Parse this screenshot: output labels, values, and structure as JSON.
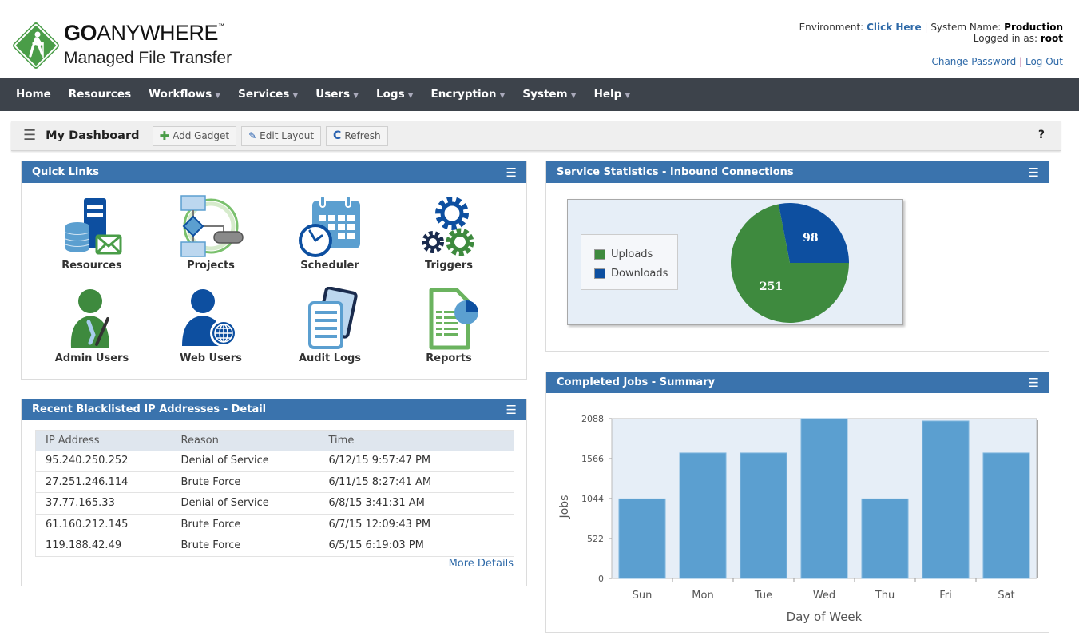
{
  "header": {
    "logo_bold": "GO",
    "logo_light": "ANYWHERE",
    "logo_tm": "™",
    "logo_subtitle": "Managed File Transfer",
    "environment_label": "Environment:",
    "environment_link": "Click Here",
    "separator": "|",
    "system_name_label": "System Name:",
    "system_name": "Production",
    "logged_in_label": "Logged in as:",
    "logged_in_user": "root",
    "change_password": "Change Password",
    "log_out": "Log Out"
  },
  "nav": {
    "items": [
      {
        "label": "Home",
        "dropdown": false
      },
      {
        "label": "Resources",
        "dropdown": false
      },
      {
        "label": "Workflows",
        "dropdown": true
      },
      {
        "label": "Services",
        "dropdown": true
      },
      {
        "label": "Users",
        "dropdown": true
      },
      {
        "label": "Logs",
        "dropdown": true
      },
      {
        "label": "Encryption",
        "dropdown": true
      },
      {
        "label": "System",
        "dropdown": true
      },
      {
        "label": "Help",
        "dropdown": true
      }
    ],
    "caret": "▼"
  },
  "toolbar": {
    "menu_icon": "☰",
    "title": "My Dashboard",
    "add_gadget": "Add Gadget",
    "edit_layout": "Edit Layout",
    "refresh": "Refresh",
    "help": "?"
  },
  "quick_links": {
    "title": "Quick Links",
    "menu_icon": "☰",
    "items": [
      {
        "label": "Resources",
        "icon": "resources-icon"
      },
      {
        "label": "Projects",
        "icon": "projects-icon"
      },
      {
        "label": "Scheduler",
        "icon": "scheduler-icon"
      },
      {
        "label": "Triggers",
        "icon": "triggers-icon"
      },
      {
        "label": "Admin Users",
        "icon": "admin-users-icon"
      },
      {
        "label": "Web Users",
        "icon": "web-users-icon"
      },
      {
        "label": "Audit Logs",
        "icon": "audit-logs-icon"
      },
      {
        "label": "Reports",
        "icon": "reports-icon"
      }
    ]
  },
  "blacklist": {
    "title": "Recent Blacklisted IP Addresses - Detail",
    "menu_icon": "☰",
    "columns": [
      "IP Address",
      "Reason",
      "Time"
    ],
    "rows": [
      [
        "95.240.250.252",
        "Denial of Service",
        "6/12/15 9:57:47 PM"
      ],
      [
        "27.251.246.114",
        "Brute Force",
        "6/11/15 8:27:41 AM"
      ],
      [
        "37.77.165.33",
        "Denial of Service",
        "6/8/15 3:41:31 AM"
      ],
      [
        "61.160.212.145",
        "Brute Force",
        "6/7/15 12:09:43 PM"
      ],
      [
        "119.188.42.49",
        "Brute Force",
        "6/5/15 6:19:03 PM"
      ]
    ],
    "more_details": "More Details"
  },
  "colors": {
    "nav_bg": "#3d434b",
    "panel_header": "#3a73ad",
    "uploads": "#3e8a3e",
    "downloads": "#0d4fa0",
    "bar": "#5b9fd0",
    "plot_bg": "#e6eef7",
    "link": "#2f6aa8"
  },
  "chart_data": [
    {
      "type": "pie",
      "title": "Service Statistics - Inbound Connections",
      "menu_icon": "☰",
      "categories": [
        "Uploads",
        "Downloads"
      ],
      "values": [
        251,
        98
      ],
      "colors": [
        "#3e8a3e",
        "#0d4fa0"
      ],
      "legend": "left"
    },
    {
      "type": "bar",
      "title": "Completed Jobs - Summary",
      "menu_icon": "☰",
      "categories": [
        "Sun",
        "Mon",
        "Tue",
        "Wed",
        "Thu",
        "Fri",
        "Sat"
      ],
      "values": [
        1040,
        1640,
        1640,
        2088,
        1040,
        2057,
        1640
      ],
      "xlabel": "Day of Week",
      "ylabel": "Jobs",
      "ylim": [
        0,
        2088
      ],
      "yticks": [
        0,
        522,
        1044,
        1566,
        2088
      ],
      "grid": false
    }
  ]
}
